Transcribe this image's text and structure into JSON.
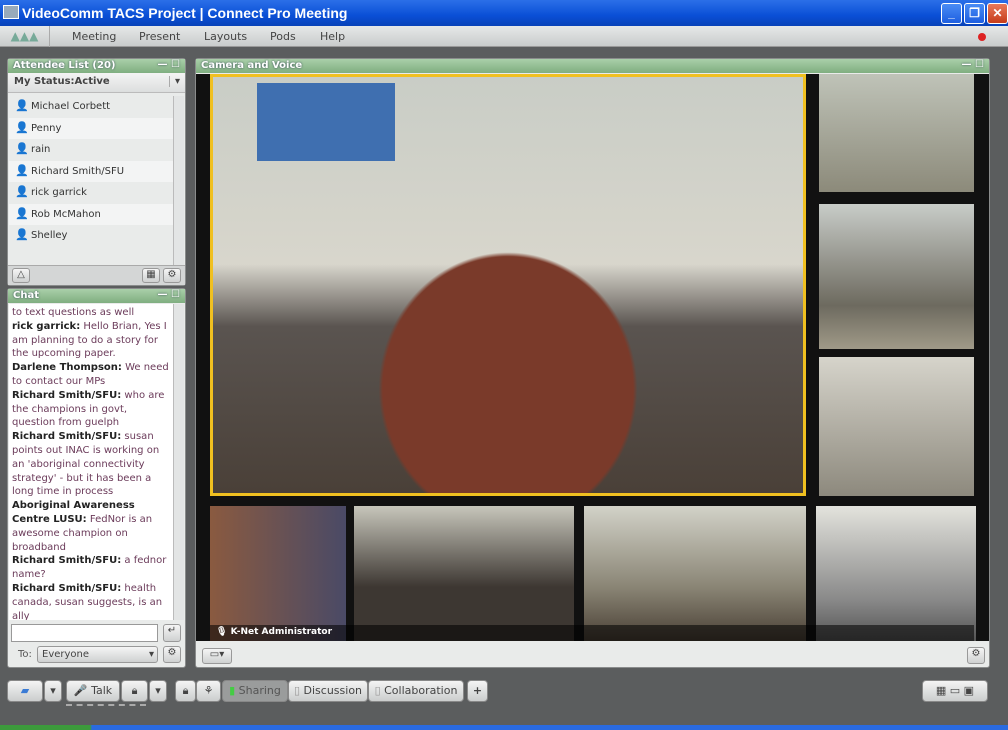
{
  "window": {
    "title": "VideoComm TACS Project  | Connect Pro Meeting"
  },
  "menu": [
    "Meeting",
    "Present",
    "Layouts",
    "Pods",
    "Help"
  ],
  "attendees": {
    "title": "Attendee List (20)",
    "status": "My Status:Active",
    "items": [
      "Michael Corbett",
      "Penny",
      "rain",
      "Richard Smith/SFU",
      "rick garrick",
      "Rob McMahon",
      "Shelley"
    ]
  },
  "chat": {
    "title": "Chat",
    "messages": [
      {
        "author": "",
        "text": "to text questions as well"
      },
      {
        "author": "rick garrick:",
        "text": " Hello Brian, Yes I am planning to do a story for the upcoming paper."
      },
      {
        "author": "Darlene Thompson:",
        "text": " We need to contact our MPs"
      },
      {
        "author": "Richard Smith/SFU:",
        "text": " who are the champions in govt, question from guelph"
      },
      {
        "author": "Richard Smith/SFU:",
        "text": " susan points out INAC is working on an 'aboriginal connectivity strategy' - but it has been a long time in process"
      },
      {
        "author": "Aboriginal Awareness Centre LUSU:",
        "text": " FedNor is an awesome champion on broadband"
      },
      {
        "author": "Richard Smith/SFU:",
        "text": " a fednor name?"
      },
      {
        "author": "Richard Smith/SFU:",
        "text": " health canada, susan suggests, is an ally"
      }
    ],
    "input_value": "",
    "to_label": "To:",
    "to_value": "Everyone"
  },
  "camera": {
    "title": "Camera and Voice",
    "speaker": "K-Net Administrator",
    "active_border": "#f0c020"
  },
  "toolbar": {
    "talk": "Talk",
    "layouts": [
      "Sharing",
      "Discussion",
      "Collaboration"
    ],
    "active_layout": "Sharing",
    "add": "+"
  }
}
